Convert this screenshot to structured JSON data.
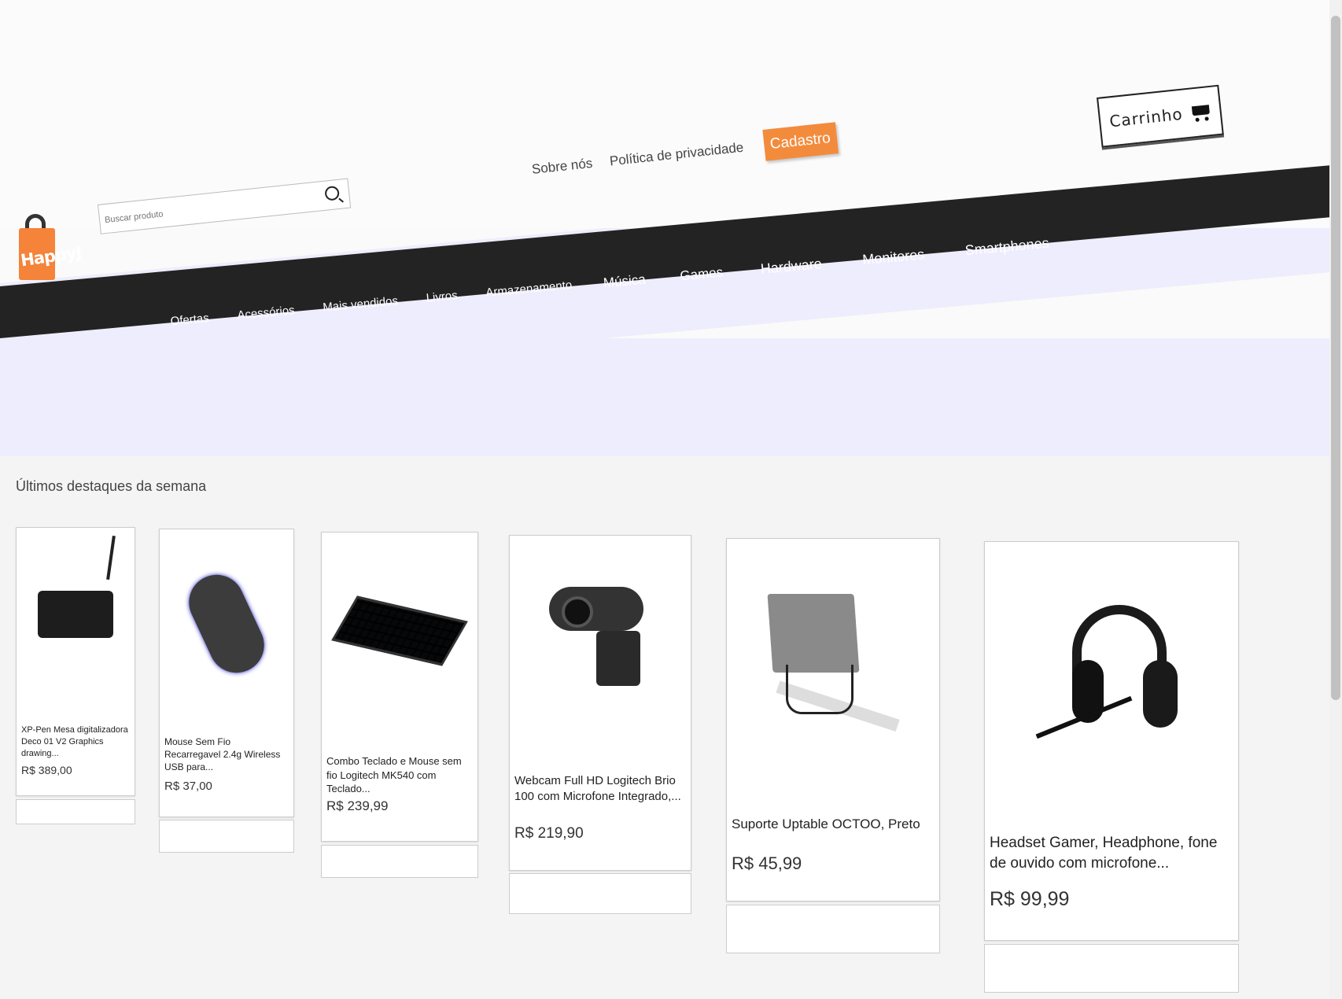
{
  "header": {
    "logo_text": "HappyJ",
    "search_placeholder": "Buscar produto",
    "links": [
      "Sobre nós",
      "Política de privacidade"
    ],
    "signup_label": "Cadastro",
    "cart_label": "Carrinho"
  },
  "nav": {
    "items": [
      "Ofertas",
      "Acessórios",
      "Mais vendidos",
      "Livros",
      "Armazenamento",
      "Música",
      "Games",
      "Hardware",
      "Monitores",
      "Smartphones"
    ]
  },
  "section": {
    "title": "Últimos destaques da semana"
  },
  "products": [
    {
      "name": "XP-Pen Mesa digitalizadora Deco 01 V2 Graphics drawing...",
      "price": "R$ 389,00",
      "image_icon": "drawing-tablet-icon"
    },
    {
      "name": "Mouse Sem Fio Recarregavel 2.4g Wireless USB para...",
      "price": "R$ 37,00",
      "image_icon": "wireless-mouse-icon"
    },
    {
      "name": "Combo Teclado e Mouse sem fio Logitech MK540 com Teclado...",
      "price": "R$ 239,99",
      "image_icon": "keyboard-icon"
    },
    {
      "name": "Webcam Full HD Logitech Brio 100 com Microfone Integrado,...",
      "price": "R$ 219,90",
      "image_icon": "webcam-icon"
    },
    {
      "name": "Suporte Uptable OCTOO, Preto",
      "price": "R$ 45,99",
      "image_icon": "laptop-stand-icon"
    },
    {
      "name": "Headset Gamer, Headphone, fone de ouvido com microfone...",
      "price": "R$ 99,99",
      "image_icon": "headset-icon"
    }
  ],
  "colors": {
    "accent": "#f38b3d",
    "nav_bg": "#232323",
    "banner_bg": "#eeedfd"
  }
}
